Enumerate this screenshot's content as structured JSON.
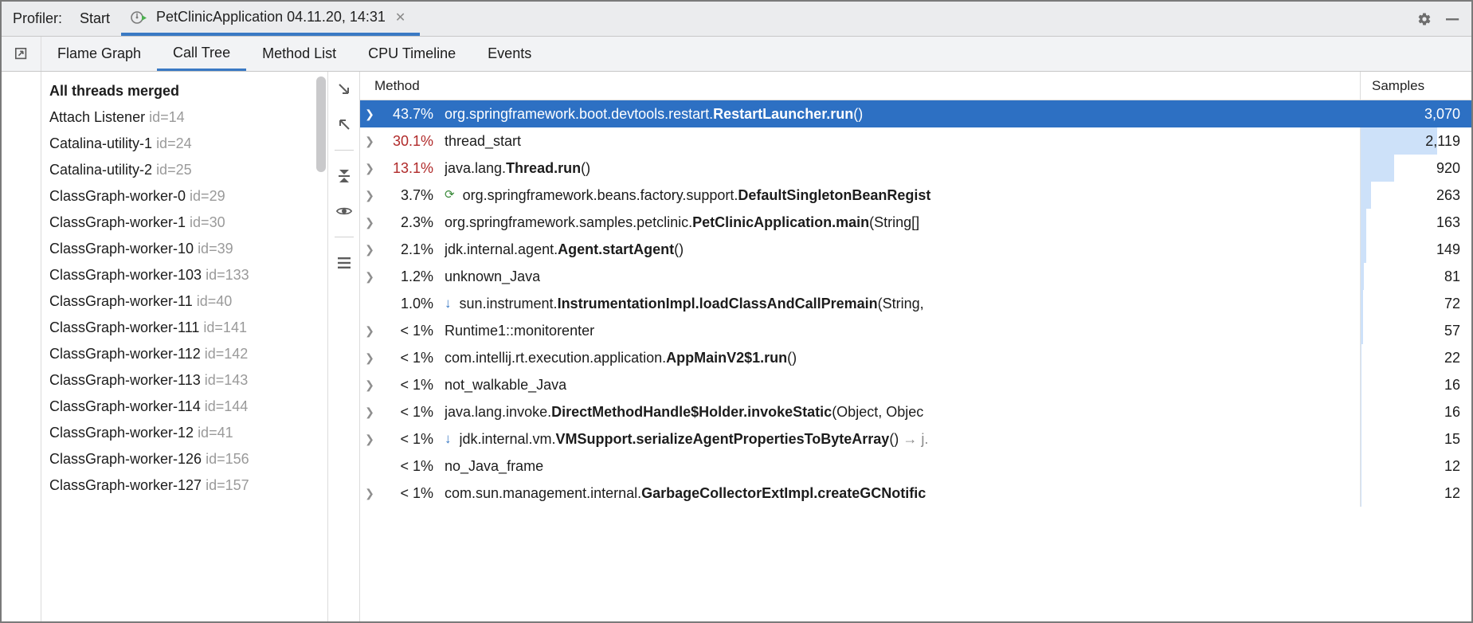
{
  "toolbar": {
    "title": "Profiler:",
    "start": "Start",
    "tab_label": "PetClinicApplication 04.11.20, 14:31"
  },
  "subtabs": {
    "flame_graph": "Flame Graph",
    "call_tree": "Call Tree",
    "method_list": "Method List",
    "cpu_timeline": "CPU Timeline",
    "events": "Events"
  },
  "threads": {
    "header": "All threads merged",
    "items": [
      {
        "name": "Attach Listener",
        "id": "id=14"
      },
      {
        "name": "Catalina-utility-1",
        "id": "id=24"
      },
      {
        "name": "Catalina-utility-2",
        "id": "id=25"
      },
      {
        "name": "ClassGraph-worker-0",
        "id": "id=29"
      },
      {
        "name": "ClassGraph-worker-1",
        "id": "id=30"
      },
      {
        "name": "ClassGraph-worker-10",
        "id": "id=39"
      },
      {
        "name": "ClassGraph-worker-103",
        "id": "id=133"
      },
      {
        "name": "ClassGraph-worker-11",
        "id": "id=40"
      },
      {
        "name": "ClassGraph-worker-111",
        "id": "id=141"
      },
      {
        "name": "ClassGraph-worker-112",
        "id": "id=142"
      },
      {
        "name": "ClassGraph-worker-113",
        "id": "id=143"
      },
      {
        "name": "ClassGraph-worker-114",
        "id": "id=144"
      },
      {
        "name": "ClassGraph-worker-12",
        "id": "id=41"
      },
      {
        "name": "ClassGraph-worker-126",
        "id": "id=156"
      },
      {
        "name": "ClassGraph-worker-127",
        "id": "id=157"
      }
    ]
  },
  "call_tree": {
    "header_method": "Method",
    "header_samples": "Samples",
    "max_samples": 3070,
    "rows": [
      {
        "caret": true,
        "selected": true,
        "pct": "43.7%",
        "pct_red": false,
        "icon": "",
        "prefix": "org.springframework.boot.devtools.restart.",
        "bold": "RestartLauncher.run",
        "suffix": "()",
        "gray": "",
        "samples": "3,070",
        "bar": 100
      },
      {
        "caret": true,
        "selected": false,
        "pct": "30.1%",
        "pct_red": true,
        "icon": "",
        "prefix": "",
        "bold": "",
        "suffix": "thread_start",
        "gray": "",
        "samples": "2,119",
        "bar": 69
      },
      {
        "caret": true,
        "selected": false,
        "pct": "13.1%",
        "pct_red": true,
        "icon": "",
        "prefix": "java.lang.",
        "bold": "Thread.run",
        "suffix": "()",
        "gray": "",
        "samples": "920",
        "bar": 30
      },
      {
        "caret": true,
        "selected": false,
        "pct": "3.7%",
        "pct_red": false,
        "icon": "rec",
        "prefix": "org.springframework.beans.factory.support.",
        "bold": "DefaultSingletonBeanRegist",
        "suffix": "",
        "gray": "",
        "samples": "263",
        "bar": 9
      },
      {
        "caret": true,
        "selected": false,
        "pct": "2.3%",
        "pct_red": false,
        "icon": "",
        "prefix": "org.springframework.samples.petclinic.",
        "bold": "PetClinicApplication.main",
        "suffix": "(String[]",
        "gray": "",
        "samples": "163",
        "bar": 5
      },
      {
        "caret": true,
        "selected": false,
        "pct": "2.1%",
        "pct_red": false,
        "icon": "",
        "prefix": "jdk.internal.agent.",
        "bold": "Agent.startAgent",
        "suffix": "()",
        "gray": "",
        "samples": "149",
        "bar": 5
      },
      {
        "caret": true,
        "selected": false,
        "pct": "1.2%",
        "pct_red": false,
        "icon": "",
        "prefix": "",
        "bold": "",
        "suffix": "unknown_Java",
        "gray": "",
        "samples": "81",
        "bar": 3
      },
      {
        "caret": false,
        "selected": false,
        "pct": "1.0%",
        "pct_red": false,
        "icon": "down",
        "prefix": "sun.instrument.",
        "bold": "InstrumentationImpl.loadClassAndCallPremain",
        "suffix": "(String,",
        "gray": "",
        "samples": "72",
        "bar": 2
      },
      {
        "caret": true,
        "selected": false,
        "pct": "< 1%",
        "pct_red": false,
        "icon": "",
        "prefix": "",
        "bold": "",
        "suffix": "Runtime1::monitorenter",
        "gray": "",
        "samples": "57",
        "bar": 2
      },
      {
        "caret": true,
        "selected": false,
        "pct": "< 1%",
        "pct_red": false,
        "icon": "",
        "prefix": "com.intellij.rt.execution.application.",
        "bold": "AppMainV2$1.run",
        "suffix": "()",
        "gray": "",
        "samples": "22",
        "bar": 1
      },
      {
        "caret": true,
        "selected": false,
        "pct": "< 1%",
        "pct_red": false,
        "icon": "",
        "prefix": "",
        "bold": "",
        "suffix": "not_walkable_Java",
        "gray": "",
        "samples": "16",
        "bar": 1
      },
      {
        "caret": true,
        "selected": false,
        "pct": "< 1%",
        "pct_red": false,
        "icon": "",
        "prefix": "java.lang.invoke.",
        "bold": "DirectMethodHandle$Holder.invokeStatic",
        "suffix": "(Object, Objec",
        "gray": "",
        "samples": "16",
        "bar": 1
      },
      {
        "caret": true,
        "selected": false,
        "pct": "< 1%",
        "pct_red": false,
        "icon": "down",
        "prefix": "jdk.internal.vm.",
        "bold": "VMSupport.serializeAgentPropertiesToByteArray",
        "suffix": "()",
        "gray": " → j.",
        "samples": "15",
        "bar": 1
      },
      {
        "caret": false,
        "selected": false,
        "pct": "< 1%",
        "pct_red": false,
        "icon": "",
        "prefix": "",
        "bold": "",
        "suffix": "no_Java_frame",
        "gray": "",
        "samples": "12",
        "bar": 1
      },
      {
        "caret": true,
        "selected": false,
        "pct": "< 1%",
        "pct_red": false,
        "icon": "",
        "prefix": "com.sun.management.internal.",
        "bold": "GarbageCollectorExtImpl.createGCNotific",
        "suffix": "",
        "gray": "",
        "samples": "12",
        "bar": 1
      }
    ]
  }
}
